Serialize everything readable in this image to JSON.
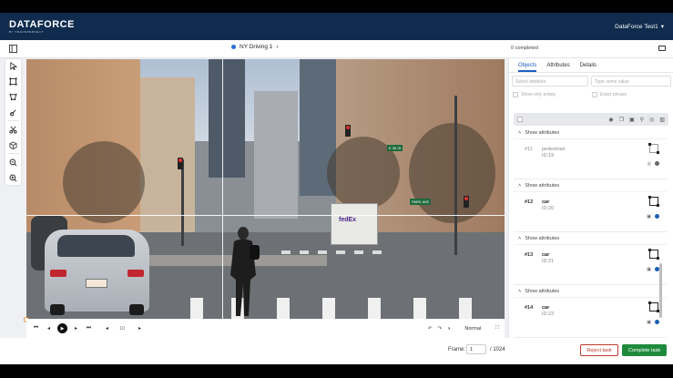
{
  "header": {
    "logo": "DATAFORCE",
    "logo_sub": "BY TRANSPERFECT",
    "user": "DataForce Test1"
  },
  "subheader": {
    "task_title": "NY Driving 1",
    "completed": "0 completed"
  },
  "toolbar": {
    "tools": [
      "cursor-icon",
      "bounding-box-icon",
      "polygon-icon",
      "brush-icon",
      "scissors-icon",
      "cube-icon",
      "zoom-out-icon",
      "zoom-in-icon"
    ]
  },
  "scene": {
    "truck_text": "fedEx",
    "street_sign_1": "E 35 St",
    "street_sign_2": "PARK AVE"
  },
  "player": {
    "speed_value": "10",
    "playback_mode": "Normal"
  },
  "footer": {
    "frame_label": "Frame:",
    "frame_value": "1",
    "frame_total": "/ 1024",
    "reject_label": "Reject task",
    "complete_label": "Complete task"
  },
  "panel": {
    "tabs": [
      "Objects",
      "Attributes",
      "Details"
    ],
    "attribute_placeholder": "Select attribute",
    "value_placeholder": "Type some value",
    "show_only_empty": "Show only empty",
    "exact_phrase": "Exact phrase",
    "show_attributes": "Show attributes",
    "objects": [
      {
        "num": "#11",
        "label": "pedestrian",
        "id": "ID:19"
      },
      {
        "num": "#12",
        "label": "car",
        "id": "ID:20"
      },
      {
        "num": "#13",
        "label": "car",
        "id": "ID:21"
      },
      {
        "num": "#14",
        "label": "car",
        "id": "ID:22"
      }
    ]
  },
  "colors": {
    "header_bg": "#0f2b4d",
    "accent": "#1f5fbf",
    "complete": "#1f8a3c",
    "reject": "#c0392b"
  }
}
